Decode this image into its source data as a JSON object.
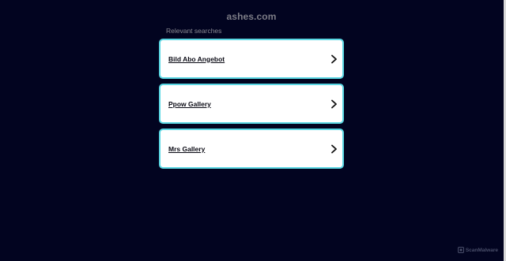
{
  "header": {
    "domain": "ashes.com"
  },
  "related": {
    "heading": "Relevant searches",
    "items": [
      {
        "label": "Bild Abo Angebot"
      },
      {
        "label": "Ppow Gallery"
      },
      {
        "label": "Mrs Gallery"
      }
    ]
  },
  "footer": {
    "brand": "ScanMalware"
  },
  "colors": {
    "background": "#020420",
    "card_border": "#5ad7e3",
    "card_background": "#ffffff"
  },
  "icons": {
    "result_arrow": "chevron-right-icon",
    "brand_logo": "scanmalware-logo-icon"
  }
}
